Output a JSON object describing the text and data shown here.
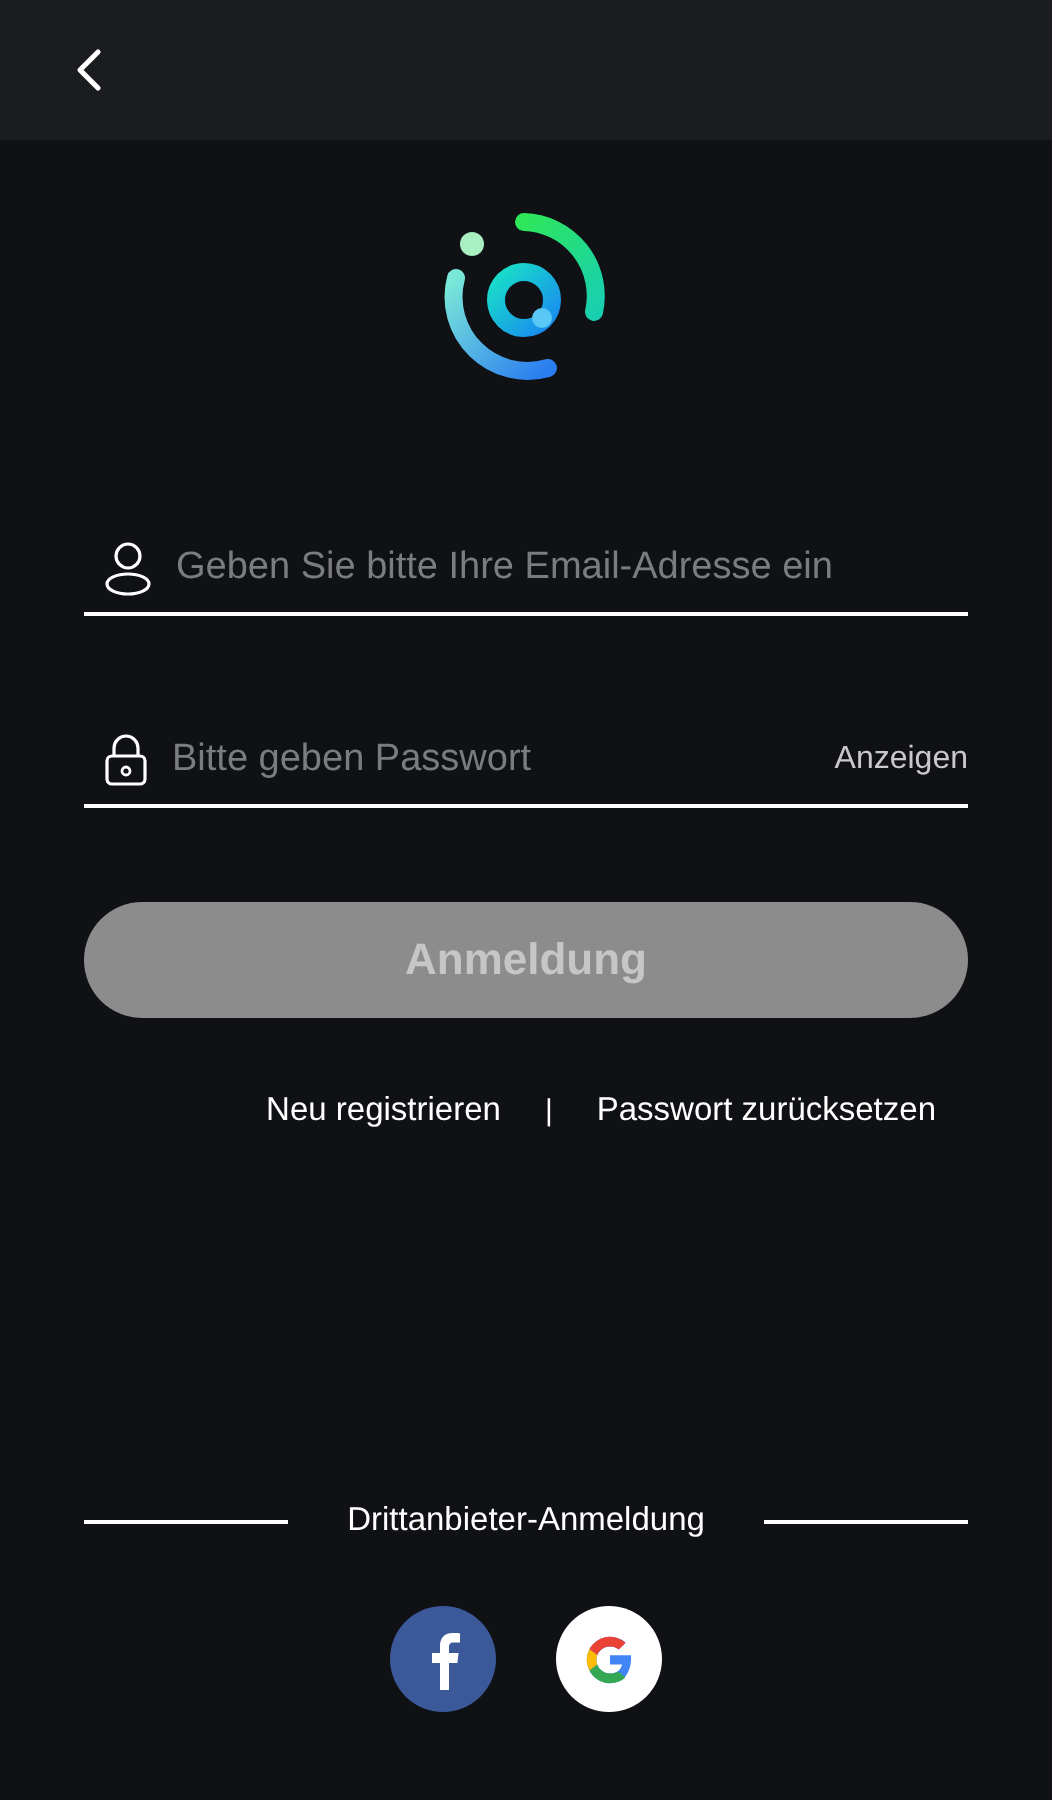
{
  "fields": [
    {
      "kind": "email",
      "placeholder": "Geben Sie bitte Ihre Email-Adresse ein"
    },
    {
      "kind": "password",
      "placeholder": "Bitte geben Passwort",
      "toggle": "Anzeigen"
    }
  ],
  "login_button": {
    "label": "Anmeldung",
    "disabled": true
  },
  "links": [
    "Neu registrieren",
    "Passwort zurücksetzen"
  ],
  "link_separator": "|",
  "third_party": {
    "label": "Drittanbieter-Anmeldung",
    "providers": [
      {
        "kind": "facebook"
      },
      {
        "kind": "google"
      }
    ]
  }
}
